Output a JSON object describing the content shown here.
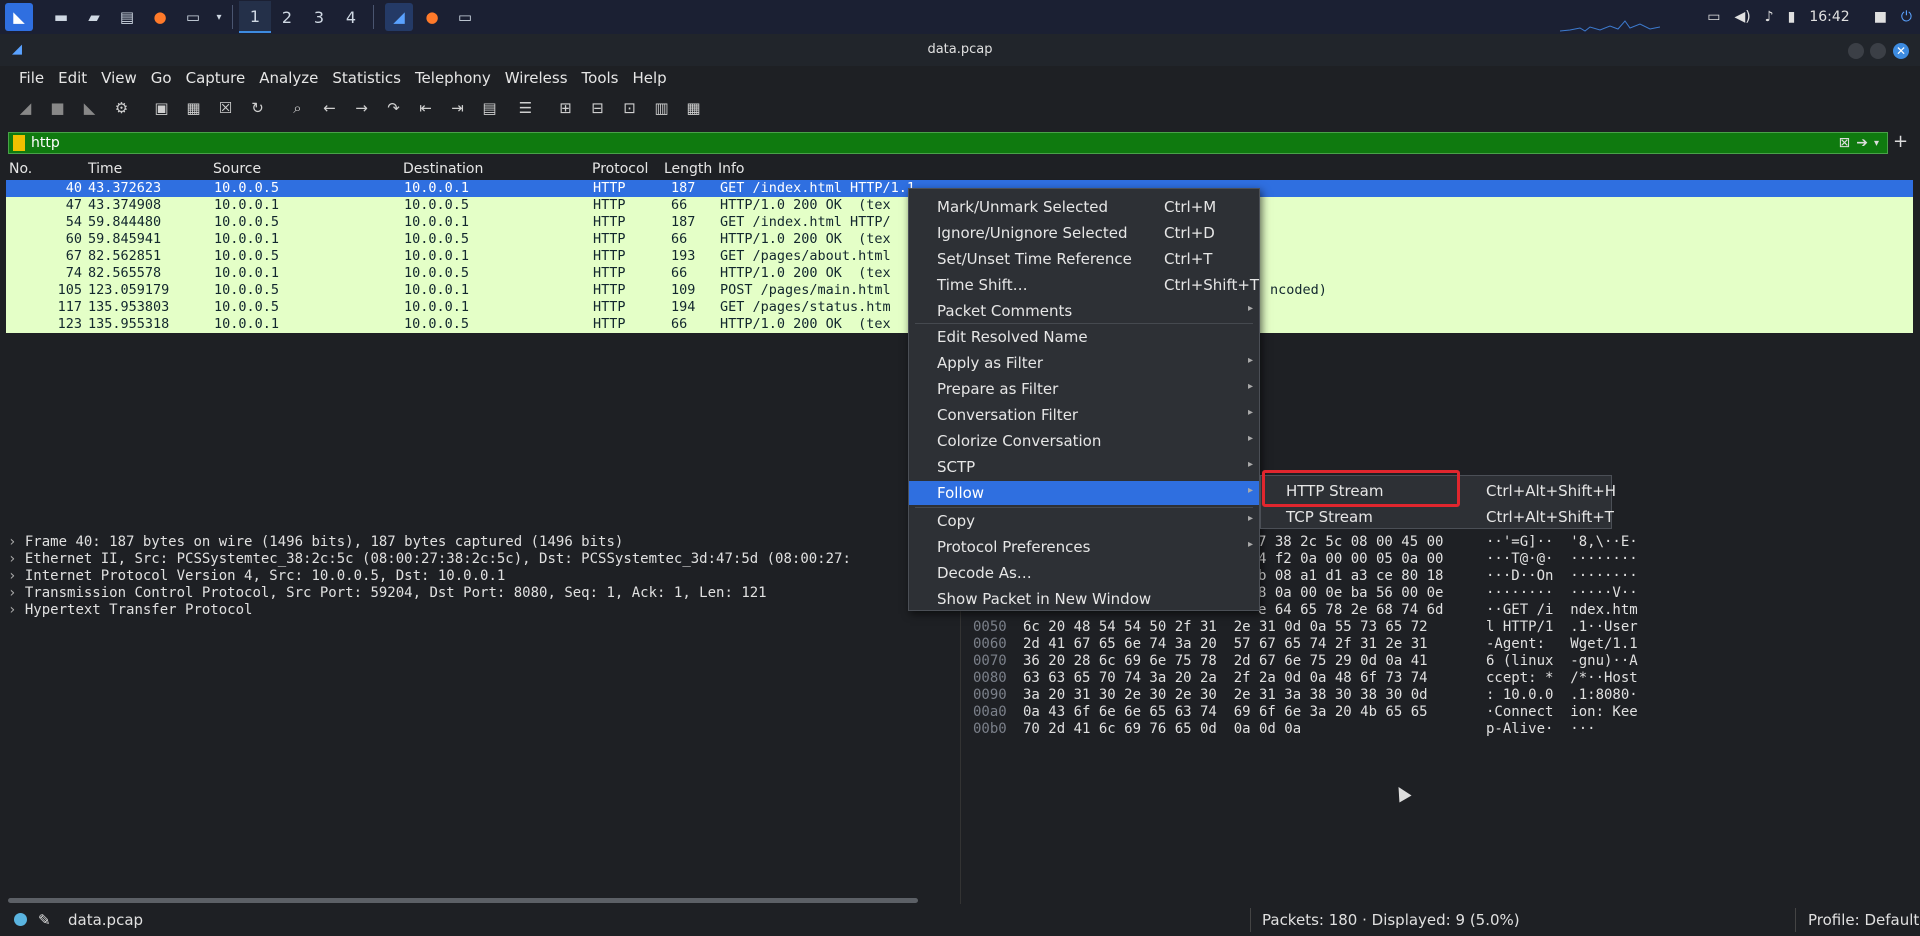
{
  "taskbar": {
    "workspaces": [
      "1",
      "2",
      "3",
      "4"
    ],
    "active_workspace": "1",
    "clock": "16:42",
    "icons": [
      "kali-menu-icon",
      "desktop-icon",
      "files-icon",
      "text-editor-icon",
      "firefox-icon",
      "terminal-icon",
      "chevron-down-icon"
    ]
  },
  "window": {
    "title": "data.pcap"
  },
  "menubar": [
    "File",
    "Edit",
    "View",
    "Go",
    "Capture",
    "Analyze",
    "Statistics",
    "Telephony",
    "Wireless",
    "Tools",
    "Help"
  ],
  "filter": {
    "value": "http"
  },
  "packet_list": {
    "columns": [
      "No.",
      "Time",
      "Source",
      "Destination",
      "Protocol",
      "Length",
      "Info"
    ],
    "rows": [
      {
        "no": "40",
        "time": "43.372623",
        "src": "10.0.0.5",
        "dst": "10.0.0.1",
        "proto": "HTTP",
        "len": "187",
        "info": "GET /index.html HTTP/1.1"
      },
      {
        "no": "47",
        "time": "43.374908",
        "src": "10.0.0.1",
        "dst": "10.0.0.5",
        "proto": "HTTP",
        "len": "66",
        "info": "HTTP/1.0 200 OK  (tex"
      },
      {
        "no": "54",
        "time": "59.844480",
        "src": "10.0.0.5",
        "dst": "10.0.0.1",
        "proto": "HTTP",
        "len": "187",
        "info": "GET /index.html HTTP/"
      },
      {
        "no": "60",
        "time": "59.845941",
        "src": "10.0.0.1",
        "dst": "10.0.0.5",
        "proto": "HTTP",
        "len": "66",
        "info": "HTTP/1.0 200 OK  (tex"
      },
      {
        "no": "67",
        "time": "82.562851",
        "src": "10.0.0.5",
        "dst": "10.0.0.1",
        "proto": "HTTP",
        "len": "193",
        "info": "GET /pages/about.html"
      },
      {
        "no": "74",
        "time": "82.565578",
        "src": "10.0.0.1",
        "dst": "10.0.0.5",
        "proto": "HTTP",
        "len": "66",
        "info": "HTTP/1.0 200 OK  (tex"
      },
      {
        "no": "105",
        "time": "123.059179",
        "src": "10.0.0.5",
        "dst": "10.0.0.1",
        "proto": "HTTP",
        "len": "109",
        "info": "POST /pages/main.html"
      },
      {
        "no": "117",
        "time": "135.953803",
        "src": "10.0.0.5",
        "dst": "10.0.0.1",
        "proto": "HTTP",
        "len": "194",
        "info": "GET /pages/status.htm"
      },
      {
        "no": "123",
        "time": "135.955318",
        "src": "10.0.0.1",
        "dst": "10.0.0.5",
        "proto": "HTTP",
        "len": "66",
        "info": "HTTP/1.0 200 OK  (tex"
      }
    ],
    "row106_tail": "ncoded)"
  },
  "details": [
    "Frame 40: 187 bytes on wire (1496 bits), 187 bytes captured (1496 bits)",
    "Ethernet II, Src: PCSSystemtec_38:2c:5c (08:00:27:38:2c:5c), Dst: PCSSystemtec_3d:47:5d (08:00:27:",
    "Internet Protocol Version 4, Src: 10.0.0.5, Dst: 10.0.0.1",
    "Transmission Control Protocol, Src Port: 59204, Dst Port: 8080, Seq: 1, Ack: 1, Len: 121",
    "Hypertext Transfer Protocol"
  ],
  "hex": [
    {
      "off": "",
      "bytes": "7 38 2c 5c 08 00 45 00",
      "ascii": "··'=G]··  '8,\\··E·"
    },
    {
      "off": "",
      "bytes": "4 f2 0a 00 00 05 0a 00",
      "ascii": "···T@·@·  ········"
    },
    {
      "off": "",
      "bytes": "b 08 a1 d1 a3 ce 80 18",
      "ascii": "···D··On  ········"
    },
    {
      "off": "",
      "bytes": "8 0a 00 0e ba 56 00 0e",
      "ascii": "········  ·····V··"
    },
    {
      "off": "",
      "bytes": "e 64 65 78 2e 68 74 6d",
      "ascii": "··GET /i  ndex.htm"
    },
    {
      "off": "0050",
      "bytes": "6c 20 48 54 54 50 2f 31  2e 31 0d 0a 55 73 65 72",
      "ascii": "l HTTP/1  .1··User"
    },
    {
      "off": "0060",
      "bytes": "2d 41 67 65 6e 74 3a 20  57 67 65 74 2f 31 2e 31",
      "ascii": "-Agent:   Wget/1.1"
    },
    {
      "off": "0070",
      "bytes": "36 20 28 6c 69 6e 75 78  2d 67 6e 75 29 0d 0a 41",
      "ascii": "6 (linux  -gnu)··A"
    },
    {
      "off": "0080",
      "bytes": "63 63 65 70 74 3a 20 2a  2f 2a 0d 0a 48 6f 73 74",
      "ascii": "ccept: *  /*··Host"
    },
    {
      "off": "0090",
      "bytes": "3a 20 31 30 2e 30 2e 30  2e 31 3a 38 30 38 30 0d",
      "ascii": ": 10.0.0  .1:8080·"
    },
    {
      "off": "00a0",
      "bytes": "0a 43 6f 6e 6e 65 63 74  69 6f 6e 3a 20 4b 65 65",
      "ascii": "·Connect  ion: Kee"
    },
    {
      "off": "00b0",
      "bytes": "70 2d 41 6c 69 76 65 0d  0a 0d 0a",
      "ascii": "p-Alive·  ···"
    }
  ],
  "context_menu": {
    "items": [
      {
        "label": "Mark/Unmark Selected",
        "shortcut": "Ctrl+M",
        "submenu": false
      },
      {
        "label": "Ignore/Unignore Selected",
        "shortcut": "Ctrl+D",
        "submenu": false
      },
      {
        "label": "Set/Unset Time Reference",
        "shortcut": "Ctrl+T",
        "submenu": false
      },
      {
        "label": "Time Shift…",
        "shortcut": "Ctrl+Shift+T",
        "submenu": false
      },
      {
        "label": "Packet Comments",
        "shortcut": "",
        "submenu": true
      },
      {
        "label": "Edit Resolved Name",
        "shortcut": "",
        "submenu": false
      },
      {
        "label": "Apply as Filter",
        "shortcut": "",
        "submenu": true
      },
      {
        "label": "Prepare as Filter",
        "shortcut": "",
        "submenu": true
      },
      {
        "label": "Conversation Filter",
        "shortcut": "",
        "submenu": true
      },
      {
        "label": "Colorize Conversation",
        "shortcut": "",
        "submenu": true
      },
      {
        "label": "SCTP",
        "shortcut": "",
        "submenu": true
      },
      {
        "label": "Follow",
        "shortcut": "",
        "submenu": true
      },
      {
        "label": "Copy",
        "shortcut": "",
        "submenu": true
      },
      {
        "label": "Protocol Preferences",
        "shortcut": "",
        "submenu": true
      },
      {
        "label": "Decode As…",
        "shortcut": "",
        "submenu": false
      },
      {
        "label": "Show Packet in New Window",
        "shortcut": "",
        "submenu": false
      }
    ],
    "highlighted": "Follow"
  },
  "follow_submenu": [
    {
      "label": "HTTP Stream",
      "shortcut": "Ctrl+Alt+Shift+H"
    },
    {
      "label": "TCP Stream",
      "shortcut": "Ctrl+Alt+Shift+T"
    }
  ],
  "status": {
    "file": "data.pcap",
    "packets": "Packets: 180 · Displayed: 9 (5.0%)",
    "profile": "Profile: Default"
  },
  "colors": {
    "row_bg": "#e4ffc7",
    "selected_row": "#2f6fe0",
    "filter_ok": "#0f7a0f",
    "highlight_box": "#e0262e"
  }
}
